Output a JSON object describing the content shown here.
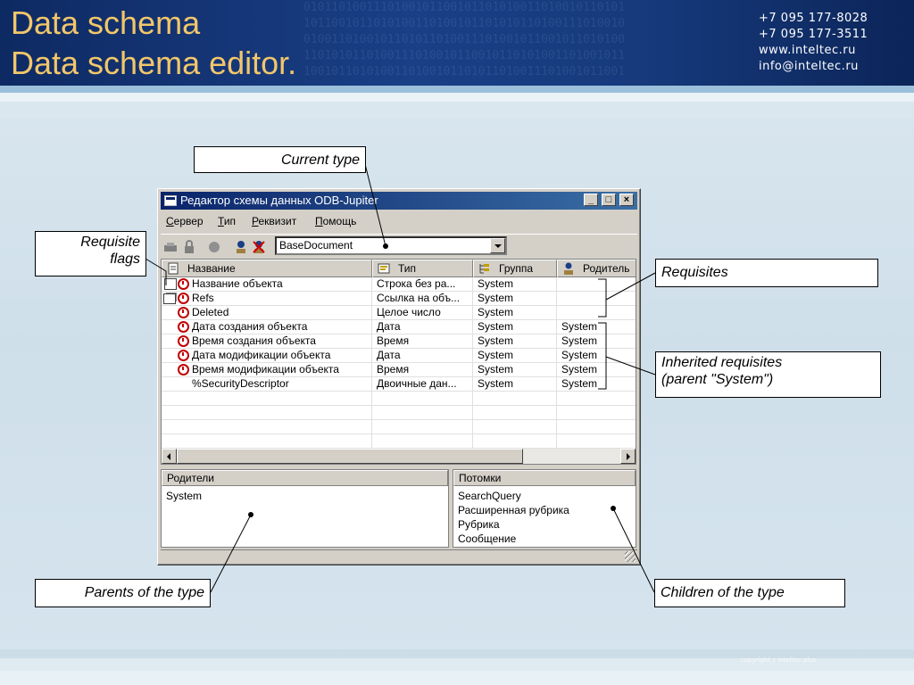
{
  "slide": {
    "title_line1": "Data schema",
    "title_line2": "Data schema editor.",
    "contacts": [
      "+7 095 177-8028",
      "+7 095 177-3511",
      "www.inteltec.ru",
      "info@inteltec.ru"
    ],
    "copyright": "copyright c inteltec plus"
  },
  "callouts": {
    "current_type": "Current type",
    "requisite_flags_line1": "Requisite",
    "requisite_flags_line2": "flags",
    "requisites": "Requisites",
    "inherited_line1": "Inherited requisites",
    "inherited_line2": "(parent \"System\")",
    "parents": "Parents of the type",
    "children": "Children of the type"
  },
  "window": {
    "title": "Редактор схемы данных ODB-Jupiter",
    "menu": [
      {
        "accel": "С",
        "rest": "ервер"
      },
      {
        "accel": "Т",
        "rest": "ип"
      },
      {
        "accel": "Р",
        "rest": "еквизит"
      },
      {
        "accel": "П",
        "rest": "омощь"
      }
    ],
    "current_type": "BaseDocument",
    "columns": [
      "Название",
      "Тип",
      "Группа",
      "Родитель"
    ],
    "rows": [
      {
        "name": "Название объекта",
        "type": "Строка без ра...",
        "group": "System",
        "parent": ""
      },
      {
        "name": "Refs",
        "type": "Ссылка на объ...",
        "group": "System",
        "parent": ""
      },
      {
        "name": "Deleted",
        "type": "Целое число",
        "group": "System",
        "parent": ""
      },
      {
        "name": "Дата создания объекта",
        "type": "Дата",
        "group": "System",
        "parent": "System"
      },
      {
        "name": "Время создания объекта",
        "type": "Время",
        "group": "System",
        "parent": "System"
      },
      {
        "name": "Дата модификации объекта",
        "type": "Дата",
        "group": "System",
        "parent": "System"
      },
      {
        "name": "Время модификации объекта",
        "type": "Время",
        "group": "System",
        "parent": "System"
      },
      {
        "name": "%SecurityDescriptor",
        "type": "Двоичные дан...",
        "group": "System",
        "parent": "System"
      }
    ],
    "parents_panel": {
      "header": "Родители",
      "items": [
        "System"
      ]
    },
    "children_panel": {
      "header": "Потомки",
      "items": [
        "SearchQuery",
        "Расширенная рубрика",
        "Рубрика",
        "Сообщение"
      ]
    }
  },
  "colors": {
    "title": "#f2c66a",
    "header_band": "#1a3f86",
    "titlebar": "#0a246a"
  }
}
